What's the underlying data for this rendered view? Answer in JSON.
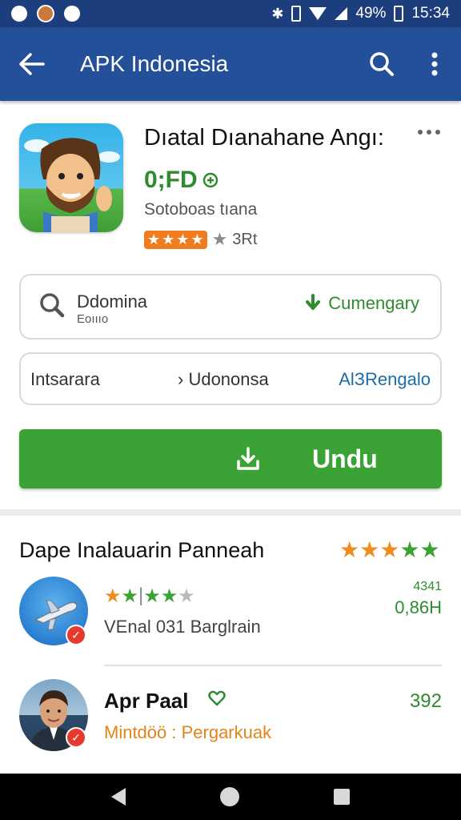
{
  "status_bar": {
    "battery": "49%",
    "time": "15:34",
    "icons": [
      "notification-icon",
      "avatar-icon",
      "circle-icon",
      "bluetooth-icon",
      "vibrate-icon",
      "wifi-icon",
      "signal-icon",
      "battery-icon"
    ]
  },
  "app_bar": {
    "title": "APK Indonesia",
    "icons": [
      "back-arrow-icon",
      "search-icon",
      "overflow-menu-icon"
    ],
    "color": "#24509a"
  },
  "app": {
    "name": "Dıatal Dıanahane Angı:",
    "price": "0;FD",
    "developer": "Sotoboas tıana",
    "rating_count": "3Rt",
    "rating_stars": 4
  },
  "search_card": {
    "title": "Ddomina",
    "subtitle": "Eoıııo",
    "category": "Cumengary"
  },
  "info_card": {
    "left": "Intsarara",
    "middle": "Udononsa",
    "right": "AlЗRengalo"
  },
  "download": {
    "label": "Undu",
    "color": "#3ba336"
  },
  "section": {
    "title": "Dape Inalauarin Panneah",
    "stars_orange": 3,
    "stars_green": 2
  },
  "items": [
    {
      "meta_top": "4341",
      "meta_bottom": "0,86H",
      "text": "VEnal 031 Barglrain",
      "stars": 3
    },
    {
      "name": "Apr Paal",
      "count": "392",
      "subtitle": "Mintdöö : Pergarkuak"
    }
  ]
}
